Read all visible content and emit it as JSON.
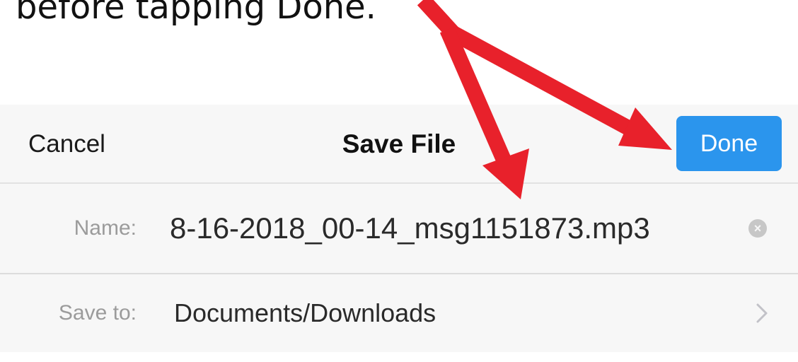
{
  "caption": {
    "text": "before tapping Done."
  },
  "navbar": {
    "cancel_label": "Cancel",
    "title": "Save File",
    "done_label": "Done"
  },
  "form": {
    "name_label": "Name:",
    "name_value": "8-16-2018_00-14_msg1151873.mp3",
    "saveto_label": "Save to:",
    "saveto_value": "Documents/Downloads"
  },
  "icons": {
    "clear": "clear-circle-icon",
    "chevron": "chevron-right-icon"
  },
  "colors": {
    "accent": "#2b95ed",
    "arrow": "#e8212b",
    "sheet_background": "#f7f7f7",
    "label_gray": "#9b9b9b"
  }
}
